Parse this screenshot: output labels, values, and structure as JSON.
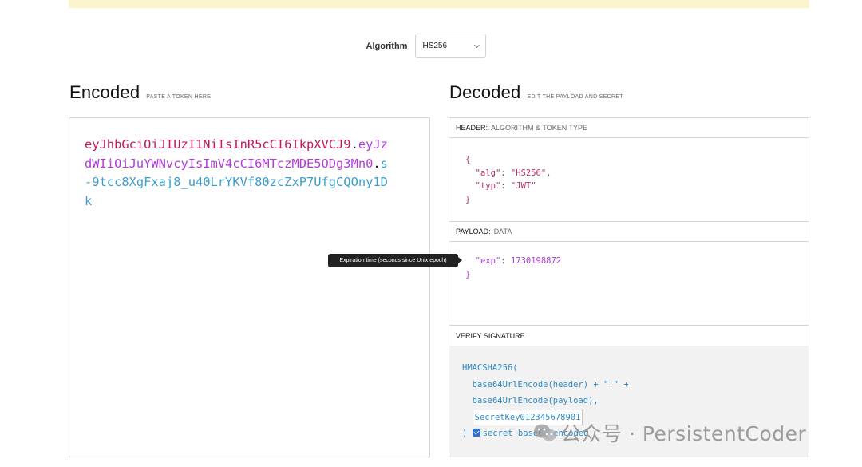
{
  "algorithm": {
    "label": "Algorithm",
    "selected": "HS256"
  },
  "encoded": {
    "title": "Encoded",
    "subtitle": "PASTE A TOKEN HERE",
    "token_header": "eyJhbGciOiJIUzI1NiIsInR5cCI6IkpXVCJ9",
    "token_payload": "eyJzdWIiOiJuYWNvcyIsImV4cCI6MTczMDE5ODg3Mn0",
    "token_signature": "s-9tcc8XgFxaj8_u40LrYKVf80zcZxP7UfgCQOny1Dk",
    "dot": "."
  },
  "decoded": {
    "title": "Decoded",
    "subtitle": "EDIT THE PAYLOAD AND SECRET",
    "header_panel": {
      "label": "HEADER:",
      "sublabel": "ALGORITHM & TOKEN TYPE",
      "alg_key": "\"alg\"",
      "alg_value": "\"HS256\"",
      "typ_key": "\"typ\"",
      "typ_value": "\"JWT\""
    },
    "payload_panel": {
      "label": "PAYLOAD:",
      "sublabel": "DATA",
      "exp_key": "\"exp\"",
      "exp_value": "1730198872"
    },
    "verify_panel": {
      "label": "VERIFY SIGNATURE",
      "func_open": "HMACSHA256(",
      "line1": "base64UrlEncode(header) + \".\" +",
      "line2": "base64UrlEncode(payload),",
      "secret_value": "SecretKey012345678901",
      "close": ")",
      "secret_checkbox_label": "secret base64 encoded"
    }
  },
  "tooltip": {
    "text": "Expiration time (seconds since Unix epoch)"
  },
  "watermark": {
    "text": "公众号 · PersistentCoder"
  },
  "colors": {
    "header": "#c2185b",
    "payload": "#b13bd8",
    "signature": "#3d9ecb",
    "warning_bg": "#fbf4cc"
  }
}
